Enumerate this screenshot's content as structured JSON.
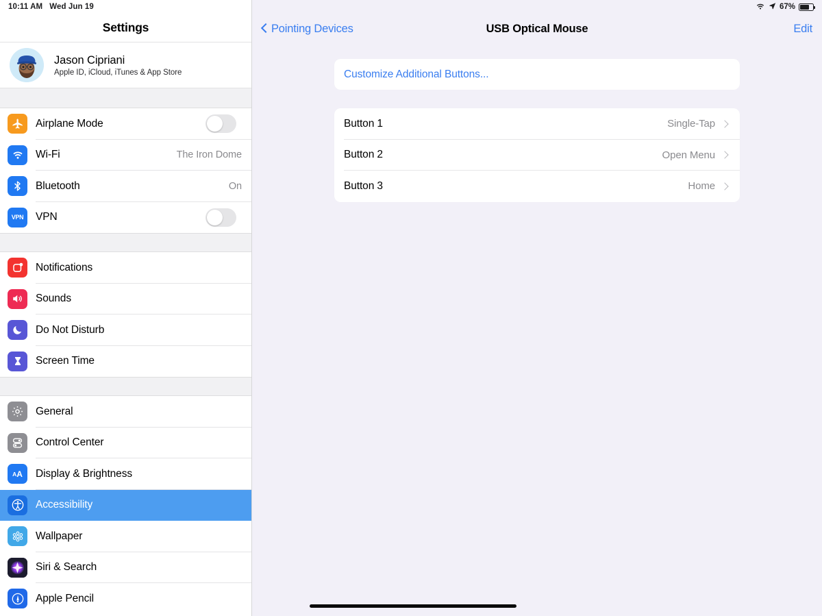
{
  "status_bar": {
    "time": "10:11 AM",
    "date": "Wed Jun 19",
    "battery_percent": "67%",
    "battery_level": 67,
    "wifi_icon": "wifi-icon",
    "location_icon": "location-arrow-icon",
    "battery_icon": "battery-icon"
  },
  "sidebar": {
    "title": "Settings",
    "profile": {
      "name": "Jason Cipriani",
      "subtitle": "Apple ID, iCloud, iTunes & App Store",
      "avatar_icon": "memoji-avatar"
    },
    "groups": [
      {
        "items": [
          {
            "label": "Airplane Mode",
            "icon": "airplane-icon",
            "icon_color": "#f79a1e",
            "accessory": "toggle",
            "toggle_on": false
          },
          {
            "label": "Wi-Fi",
            "icon": "wifi-icon",
            "icon_color": "#2079f2",
            "accessory": "value",
            "value": "The Iron Dome"
          },
          {
            "label": "Bluetooth",
            "icon": "bluetooth-icon",
            "icon_color": "#2079f2",
            "accessory": "value",
            "value": "On"
          },
          {
            "label": "VPN",
            "icon": "vpn-icon",
            "icon_color": "#2079f2",
            "accessory": "toggle",
            "toggle_on": false
          }
        ]
      },
      {
        "items": [
          {
            "label": "Notifications",
            "icon": "notifications-icon",
            "icon_color": "#f3332f",
            "accessory": "none"
          },
          {
            "label": "Sounds",
            "icon": "sounds-icon",
            "icon_color": "#ee2b53",
            "accessory": "none"
          },
          {
            "label": "Do Not Disturb",
            "icon": "moon-icon",
            "icon_color": "#5856d6",
            "accessory": "none"
          },
          {
            "label": "Screen Time",
            "icon": "hourglass-icon",
            "icon_color": "#5856d6",
            "accessory": "none"
          }
        ]
      },
      {
        "items": [
          {
            "label": "General",
            "icon": "gear-icon",
            "icon_color": "#8e8e93",
            "accessory": "none"
          },
          {
            "label": "Control Center",
            "icon": "sliders-icon",
            "icon_color": "#8e8e93",
            "accessory": "none"
          },
          {
            "label": "Display & Brightness",
            "icon": "display-brightness-icon",
            "icon_color": "#2079f2",
            "accessory": "none"
          },
          {
            "label": "Accessibility",
            "icon": "accessibility-icon",
            "icon_color": "#1a6ee0",
            "accessory": "none",
            "selected": true
          },
          {
            "label": "Wallpaper",
            "icon": "wallpaper-icon",
            "icon_color": "#41a8e8",
            "accessory": "none"
          },
          {
            "label": "Siri & Search",
            "icon": "siri-icon",
            "icon_color": "#1c1c2e",
            "accessory": "none"
          },
          {
            "label": "Apple Pencil",
            "icon": "apple-pencil-icon",
            "icon_color": "#2069e8",
            "accessory": "none"
          }
        ]
      }
    ],
    "selected_item": "Accessibility"
  },
  "detail": {
    "back_label": "Pointing Devices",
    "title": "USB Optical Mouse",
    "edit_label": "Edit",
    "customize_link": "Customize Additional Buttons...",
    "button_rows": [
      {
        "label": "Button 1",
        "value": "Single-Tap"
      },
      {
        "label": "Button 2",
        "value": "Open Menu"
      },
      {
        "label": "Button 3",
        "value": "Home"
      }
    ]
  },
  "colors": {
    "accent_blue": "#3a7ef0",
    "selected_row": "#4d9df0",
    "detail_bg": "#f2f0f8",
    "card_bg": "#ffffff",
    "secondary_text": "#8a8a8e"
  }
}
